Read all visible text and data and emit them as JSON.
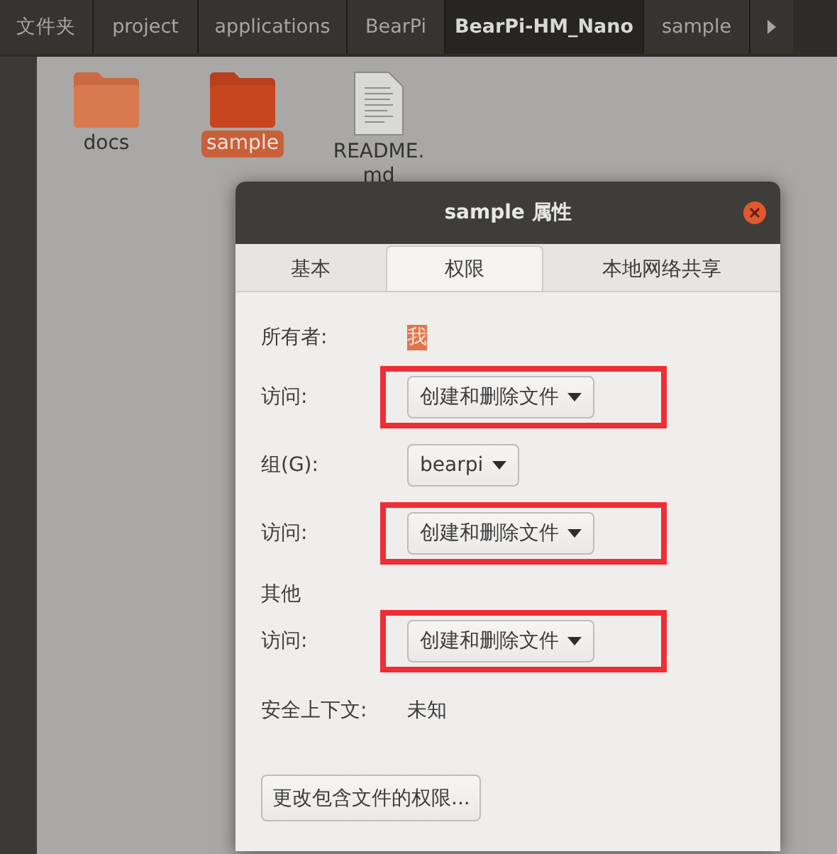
{
  "path_bar": {
    "segments": [
      {
        "label": "文件夹",
        "selected": false
      },
      {
        "label": "project",
        "selected": false
      },
      {
        "label": "applications",
        "selected": false
      },
      {
        "label": "BearPi",
        "selected": false
      },
      {
        "label": "BearPi-HM_Nano",
        "selected": true
      },
      {
        "label": "sample",
        "selected": false
      }
    ]
  },
  "files": [
    {
      "name": "docs",
      "kind": "folder",
      "selected": false
    },
    {
      "name": "sample",
      "kind": "folder",
      "selected": true
    },
    {
      "name": "README.\nmd",
      "kind": "document",
      "selected": false
    }
  ],
  "dialog": {
    "title": "sample 属性",
    "tabs": [
      {
        "label": "基本",
        "selected": false
      },
      {
        "label": "权限",
        "selected": true
      },
      {
        "label": "本地网络共享",
        "selected": false
      }
    ],
    "rows": [
      {
        "kind": "value",
        "label": "所有者:",
        "value": "我",
        "selected": true
      },
      {
        "kind": "combo",
        "label": "访问:",
        "value": "创建和删除文件",
        "highlighted": true
      },
      {
        "kind": "combo",
        "label": "组(G):",
        "value": "bearpi",
        "highlighted": false
      },
      {
        "kind": "combo",
        "label": "访问:",
        "value": "创建和删除文件",
        "highlighted": true
      },
      {
        "kind": "heading",
        "label": "其他"
      },
      {
        "kind": "combo",
        "label": "访问:",
        "value": "创建和删除文件",
        "highlighted": true
      },
      {
        "kind": "text",
        "label": "安全上下文:",
        "value": "未知"
      }
    ],
    "button": "更改包含文件的权限..."
  }
}
